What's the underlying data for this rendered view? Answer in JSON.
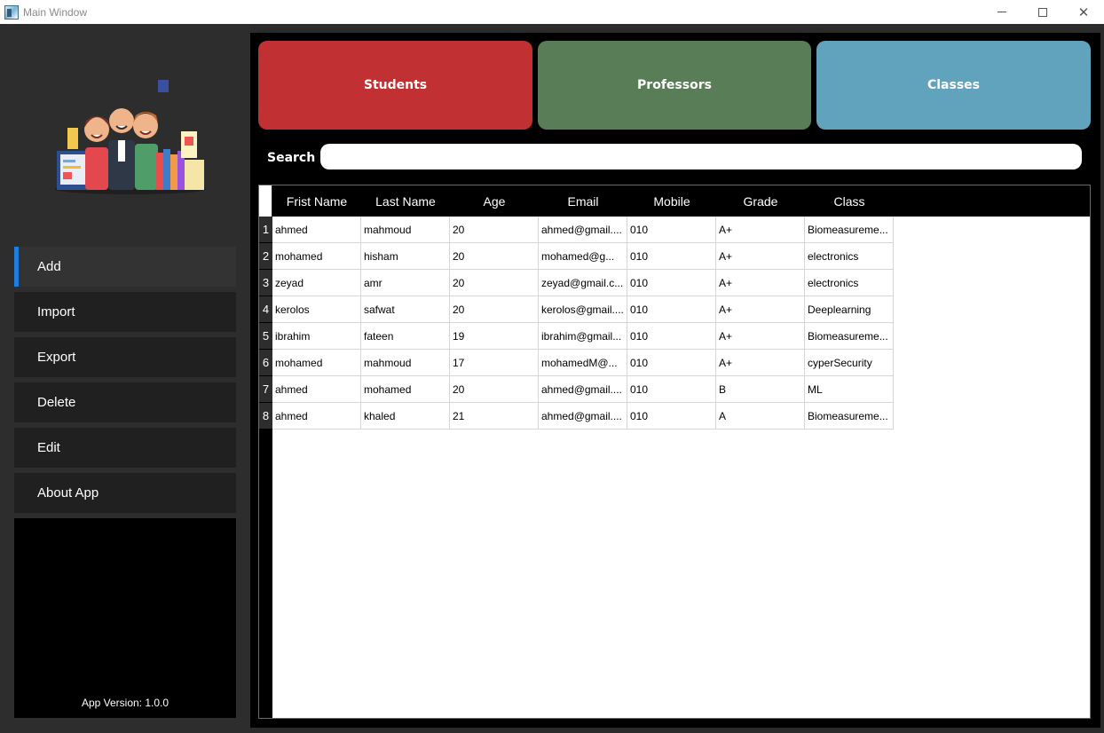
{
  "window": {
    "title": "Main Window"
  },
  "sidebar": {
    "menu": [
      {
        "label": "Add"
      },
      {
        "label": "Import"
      },
      {
        "label": "Export"
      },
      {
        "label": "Delete"
      },
      {
        "label": "Edit"
      },
      {
        "label": "About App"
      }
    ],
    "active_index": 0,
    "version_text": "App Version: 1.0.0"
  },
  "categories": [
    {
      "label": "Students",
      "color": "#c13032"
    },
    {
      "label": "Professors",
      "color": "#597d56"
    },
    {
      "label": "Classes",
      "color": "#61a3bd"
    }
  ],
  "search": {
    "label": "Search :",
    "value": "",
    "placeholder": ""
  },
  "table": {
    "columns": [
      "Frist Name",
      "Last Name",
      "Age",
      "Email",
      "Mobile",
      "Grade",
      "Class"
    ],
    "rows": [
      {
        "num": "1",
        "cells": [
          "ahmed",
          "mahmoud",
          "20",
          "ahmed@gmail....",
          "010",
          "A+",
          "Biomeasureme..."
        ]
      },
      {
        "num": "2",
        "cells": [
          "mohamed",
          "hisham",
          "20",
          "mohamed@g...",
          "010",
          "A+",
          "electronics"
        ]
      },
      {
        "num": "3",
        "cells": [
          "zeyad",
          "amr",
          "20",
          "zeyad@gmail.c...",
          "010",
          "A+",
          "electronics"
        ]
      },
      {
        "num": "4",
        "cells": [
          "kerolos",
          "safwat",
          "20",
          "kerolos@gmail....",
          "010",
          "A+",
          "Deeplearning"
        ]
      },
      {
        "num": "5",
        "cells": [
          "ibrahim",
          "fateen",
          "19",
          "ibrahim@gmail...",
          "010",
          "A+",
          "Biomeasureme..."
        ]
      },
      {
        "num": "6",
        "cells": [
          "mohamed",
          "mahmoud",
          "17",
          "mohamedM@...",
          "010",
          "A+",
          "cyperSecurity"
        ]
      },
      {
        "num": "7",
        "cells": [
          "ahmed",
          "mohamed",
          "20",
          "ahmed@gmail....",
          "010",
          "B",
          "ML"
        ]
      },
      {
        "num": "8",
        "cells": [
          "ahmed",
          "khaled",
          "21",
          "ahmed@gmail....",
          "010",
          "A",
          "Biomeasureme..."
        ]
      }
    ]
  },
  "icons": {
    "app_icon": "window-app-icon",
    "logo": "people-illustration-logo"
  }
}
